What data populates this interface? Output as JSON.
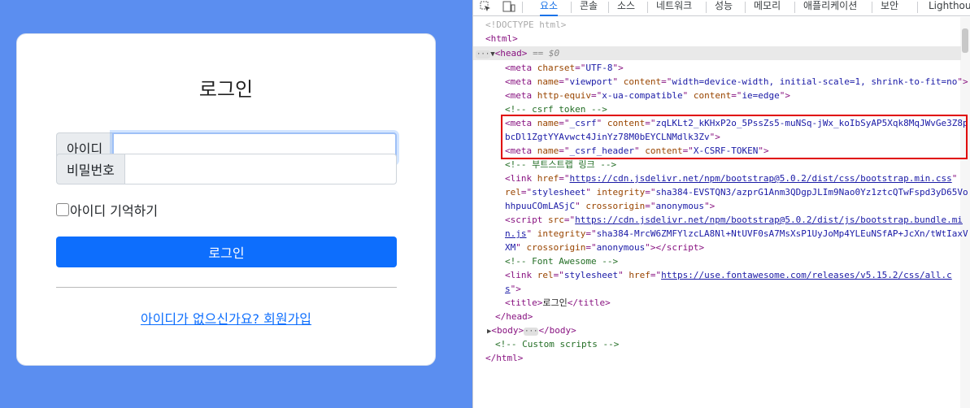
{
  "page": {
    "title": "로그인",
    "id_label": "아이디",
    "id_value": "",
    "password_label": "비밀번호",
    "password_value": "",
    "remember_label": "아이디 기억하기",
    "login_button": "로그인",
    "signup_link": "아이디가 없으신가요? 회원가입",
    "colors": {
      "background": "#5b8ef0",
      "primary": "#0d6efd"
    }
  },
  "devtools": {
    "tabs": [
      "요소",
      "콘솔",
      "소스",
      "네트워크",
      "성능",
      "메모리",
      "애플리케이션",
      "보안",
      "Lighthouse"
    ],
    "active_tab": "요소",
    "icons": [
      "inspect-element-icon",
      "device-toolbar-icon"
    ],
    "lines": {
      "doctype": "<!DOCTYPE html>",
      "html_open": "<html>",
      "head_open": "<head>",
      "head_marker": "== $0",
      "meta_charset": {
        "name": "charset",
        "value": "UTF-8"
      },
      "meta_viewport": {
        "name": "viewport",
        "content": "width=device-width, initial-scale=1, shrink-to-fit=no"
      },
      "meta_http_equiv": {
        "http_equiv": "x-ua-compatible",
        "content": "ie=edge"
      },
      "comment_csrf": "<!--  csrf token  -->",
      "meta_csrf": {
        "name": "_csrf",
        "content_line1": "zqLKLt2_kKHxP2o_5PssZs5-muNSq-jWx_koIbSyAP5Xqk8MqJWvGe3Z8p",
        "content_line2": "bcDl1ZgtYYAvwct4JinYz78M0bEYCLNMdlk3Zv"
      },
      "meta_csrf_header": {
        "name": "_csrf_header",
        "content": "X-CSRF-TOKEN"
      },
      "comment_bootstrap": "<!-- 부트스트랩 링크 -->",
      "link_bootstrap": {
        "href": "https://cdn.jsdelivr.net/npm/bootstrap@5.0.2/dist/css/bootstrap.min.css",
        "rel": "stylesheet",
        "integrity_line1": "sha384-EVSTQN3/azprG1Anm3QDgpJLIm9Nao0Yz1ztcQTwFspd3yD65Vo",
        "integrity_line2": "hhpuuCOmLASjC",
        "crossorigin": "anonymous"
      },
      "script_bootstrap": {
        "src_line1": "https://cdn.jsdelivr.net/npm/bootstrap@5.0.2/dist/js/bootstrap.bundle.mi",
        "src_line2": "n.js",
        "integrity_line1": "sha384-MrcW6ZMFYlzcLA8Nl+NtUVF0sA7MsXsP1UyJoMp4YLEuNSfAP+JcXn/tWtIaxV",
        "integrity_line2": "XM",
        "crossorigin": "anonymous"
      },
      "comment_fontawesome": "<!-- Font Awesome -->",
      "link_fontawesome": {
        "rel": "stylesheet",
        "href_line1": "https://use.fontawesome.com/releases/v5.15.2/css/all.c",
        "href_line2": "s"
      },
      "title_text": "로그인",
      "head_close": "</head>",
      "body_line": "<body> </body>",
      "comment_custom": "<!-- Custom scripts -->",
      "html_close": "</html>"
    }
  }
}
